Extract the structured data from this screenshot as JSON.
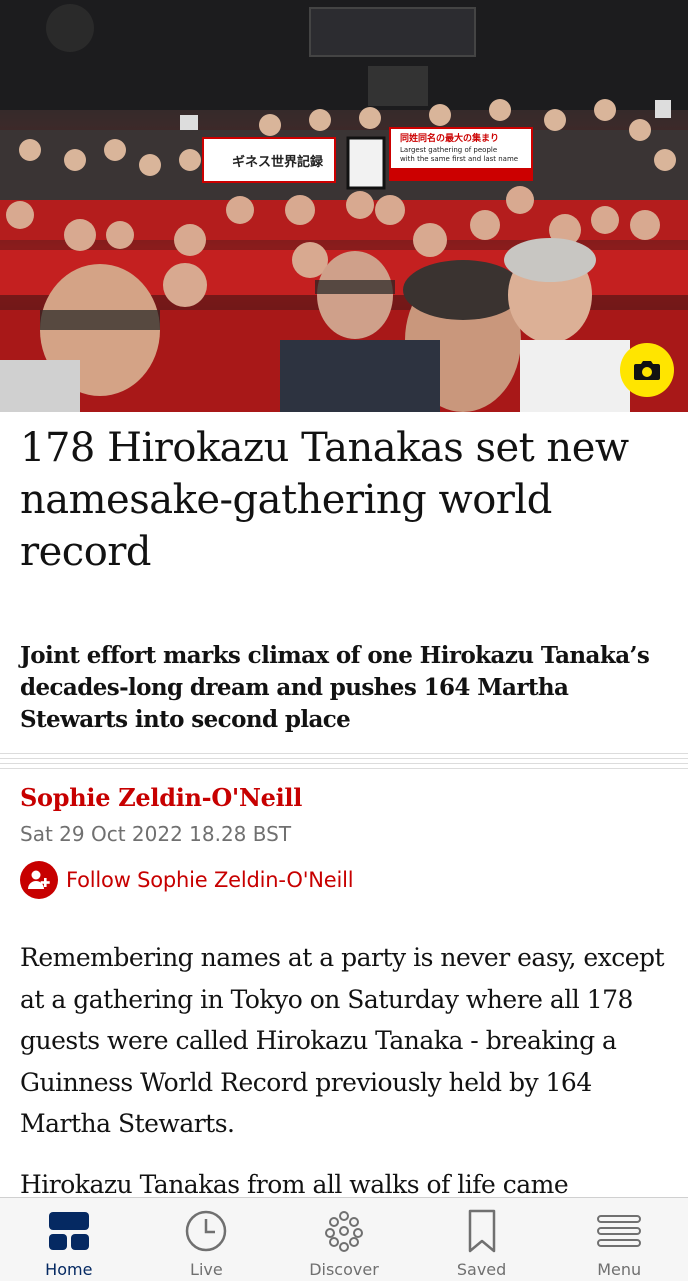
{
  "article": {
    "image_alt": "Crowd of people seated in red cinema seats raising fists",
    "headline": "178 Hirokazu Tanakas set new namesake-gathering world record",
    "standfirst": "Joint effort marks climax of one Hirokazu Tanaka’s decades-long dream and pushes 164 Martha Stewarts into second place",
    "byline": "Sophie Zeldin-O'Neill",
    "date": "Sat 29 Oct 2022 18.28 BST",
    "follow_label": "Follow Sophie Zeldin-O'Neill",
    "paragraphs": [
      "Remembering names at a party is never easy, except at a gathering in Tokyo on Saturday where all 178 guests were called Hirokazu Tanaka - breaking a Guinness World Record previously held by 164 Martha Stewarts.",
      "Hirokazu Tanakas from all walks of life came"
    ]
  },
  "banners": {
    "left_text": "ギネス世界記録",
    "right_title": "同姓同名の最大の集まり",
    "right_line1": "Largest gathering of people",
    "right_line2": "with the same first and last name"
  },
  "nav": {
    "items": [
      {
        "label": "Home",
        "icon": "home-icon",
        "active": true
      },
      {
        "label": "Live",
        "icon": "clock-icon",
        "active": false
      },
      {
        "label": "Discover",
        "icon": "discover-icon",
        "active": false
      },
      {
        "label": "Saved",
        "icon": "bookmark-icon",
        "active": false
      },
      {
        "label": "Menu",
        "icon": "menu-icon",
        "active": false
      }
    ]
  },
  "colors": {
    "accent_red": "#c70000",
    "nav_active": "#052962",
    "camera_button": "#ffe500"
  }
}
